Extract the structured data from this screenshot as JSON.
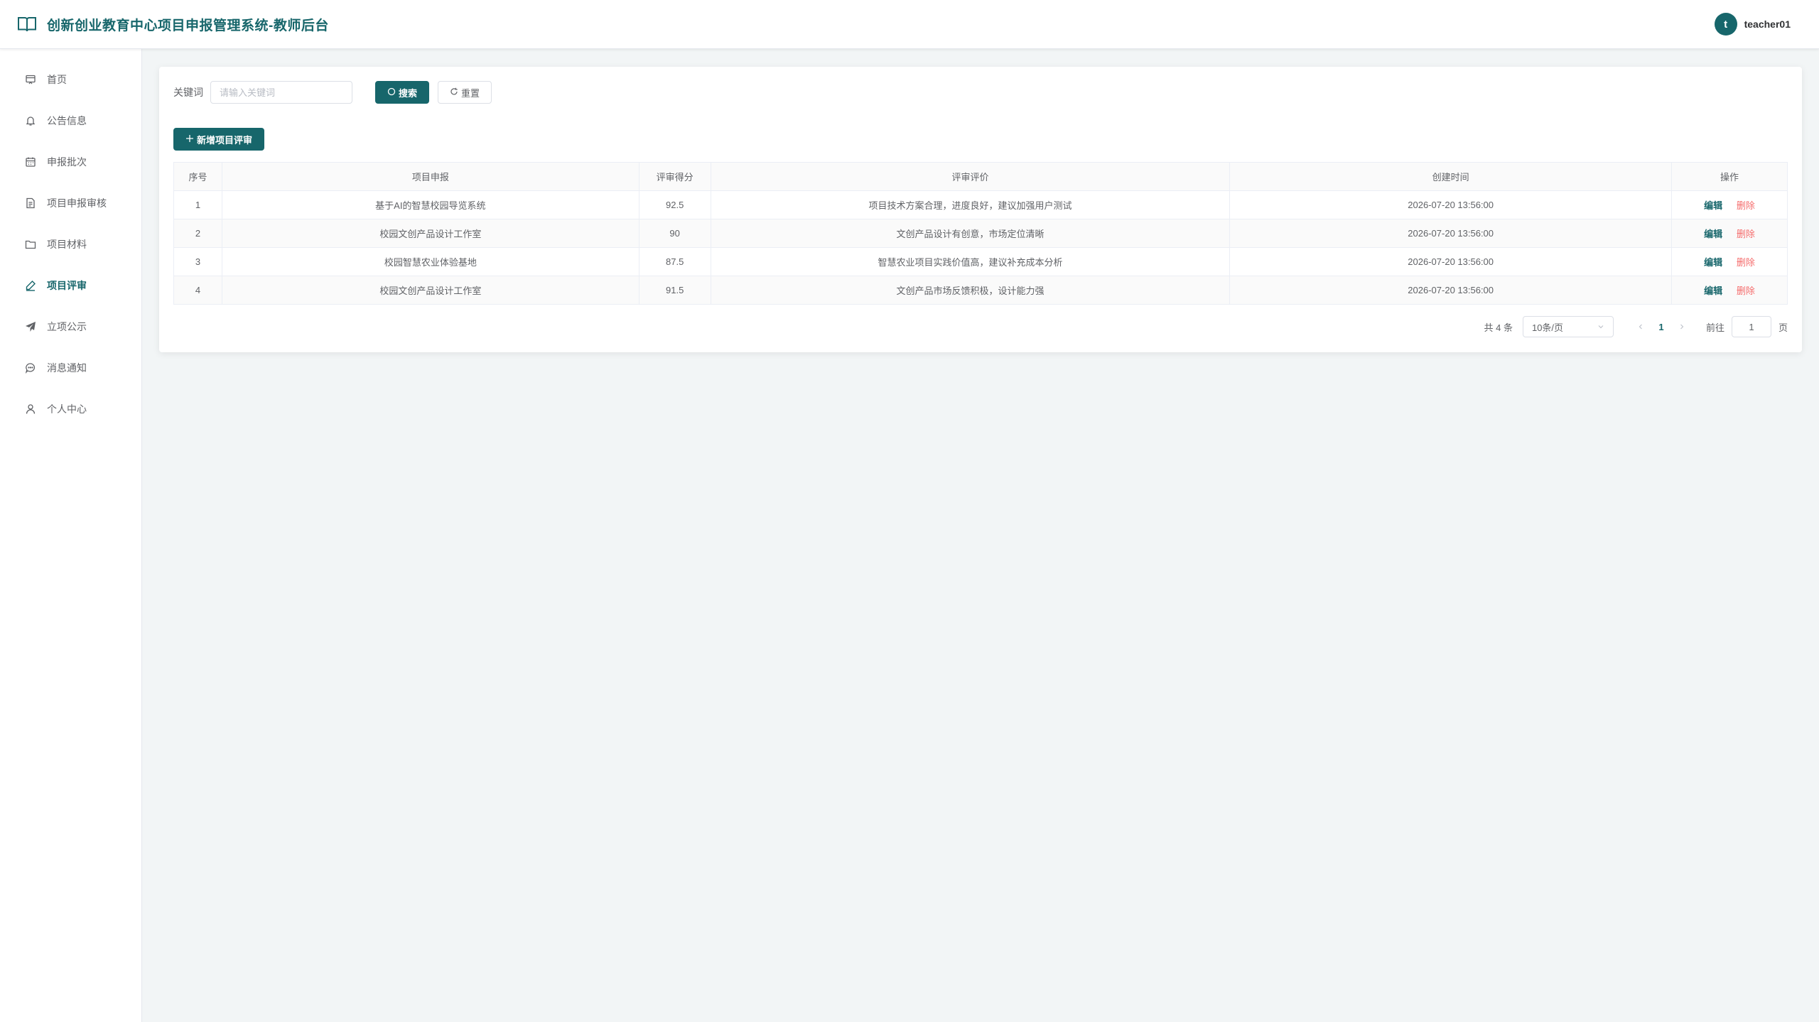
{
  "header": {
    "title": "创新创业教育中心项目申报管理系统-教师后台",
    "avatar_letter": "t",
    "username": "teacher01"
  },
  "sidebar": {
    "items": [
      {
        "label": "首页",
        "icon": "home-icon"
      },
      {
        "label": "公告信息",
        "icon": "bell-icon"
      },
      {
        "label": "申报批次",
        "icon": "calendar-icon"
      },
      {
        "label": "项目申报审核",
        "icon": "document-icon"
      },
      {
        "label": "项目材料",
        "icon": "folder-icon"
      },
      {
        "label": "项目评审",
        "icon": "edit-icon",
        "active": true
      },
      {
        "label": "立项公示",
        "icon": "send-icon"
      },
      {
        "label": "消息通知",
        "icon": "chat-icon"
      },
      {
        "label": "个人中心",
        "icon": "user-icon"
      }
    ]
  },
  "search": {
    "label": "关键词",
    "placeholder": "请输入关键词",
    "search_button": "搜索",
    "reset_button": "重置"
  },
  "add_button": "新增项目评审",
  "table": {
    "columns": [
      "序号",
      "项目申报",
      "评审得分",
      "评审评价",
      "创建时间",
      "操作"
    ],
    "rows": [
      {
        "index": "1",
        "project": "基于AI的智慧校园导览系统",
        "score": "92.5",
        "comment": "项目技术方案合理，进度良好，建议加强用户测试",
        "created": "2026-07-20 13:56:00"
      },
      {
        "index": "2",
        "project": "校园文创产品设计工作室",
        "score": "90",
        "comment": "文创产品设计有创意，市场定位清晰",
        "created": "2026-07-20 13:56:00"
      },
      {
        "index": "3",
        "project": "校园智慧农业体验基地",
        "score": "87.5",
        "comment": "智慧农业项目实践价值高，建议补充成本分析",
        "created": "2026-07-20 13:56:00"
      },
      {
        "index": "4",
        "project": "校园文创产品设计工作室",
        "score": "91.5",
        "comment": "文创产品市场反馈积极，设计能力强",
        "created": "2026-07-20 13:56:00"
      }
    ],
    "edit_label": "编辑",
    "delete_label": "删除"
  },
  "pagination": {
    "total": "共 4 条",
    "page_size": "10条/页",
    "current_page": "1",
    "goto_prefix": "前往",
    "goto_value": "1",
    "goto_suffix": "页"
  },
  "colors": {
    "primary": "#17666b",
    "danger": "#f56c6c",
    "background": "#f2f5f6"
  }
}
